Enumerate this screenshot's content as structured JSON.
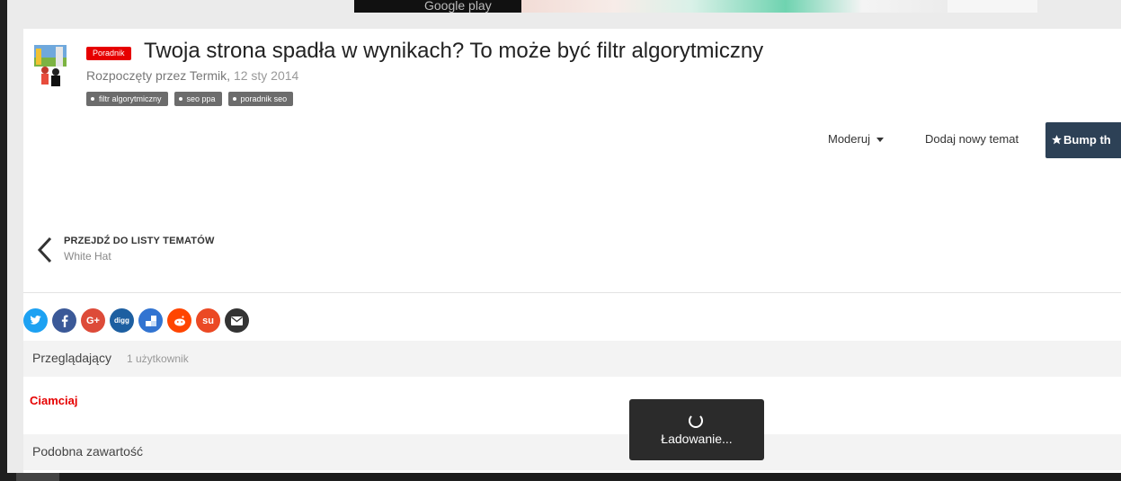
{
  "ad": {
    "store_text": "Google play",
    "colors": {
      "dark": "#111111",
      "accent": "#2eb889"
    }
  },
  "topic": {
    "badge": "Poradnik",
    "title": "Twoja strona spadła w wynikach? To może być filtr algorytmiczny",
    "started_by_prefix": "Rozpoczęty przez",
    "author": "Termik",
    "separator": ",",
    "date": "12 sty 2014",
    "tags": [
      "filtr algorytmiczny",
      "seo ppa",
      "poradnik seo"
    ]
  },
  "actions": {
    "moderate_label": "Moderuj",
    "new_topic_label": "Dodaj nowy temat",
    "bump_label": "Bump th"
  },
  "back_nav": {
    "title": "PRZEJDŹ DO LISTY TEMATÓW",
    "subtitle": "White Hat"
  },
  "share": [
    {
      "icon": "twitter-icon",
      "glyph": "t",
      "color": "#1da1f2"
    },
    {
      "icon": "facebook-icon",
      "glyph": "f",
      "color": "#3b5998"
    },
    {
      "icon": "google-plus-icon",
      "glyph": "G+",
      "color": "#dd4b39"
    },
    {
      "icon": "digg-icon",
      "glyph": "digg",
      "color": "#1d5fa1"
    },
    {
      "icon": "delicious-icon",
      "glyph": "■",
      "color": "#3274d1"
    },
    {
      "icon": "reddit-icon",
      "glyph": "☻",
      "color": "#ff4500"
    },
    {
      "icon": "stumbleupon-icon",
      "glyph": "su",
      "color": "#eb4924"
    },
    {
      "icon": "email-icon",
      "glyph": "✉",
      "color": "#333333"
    }
  ],
  "viewers": {
    "title": "Przeglądający",
    "count": "1 użytkownik",
    "users": [
      "Ciamciaj"
    ]
  },
  "similar": {
    "title": "Podobna zawartość"
  },
  "loading": {
    "text": "Ładowanie..."
  },
  "colors": {
    "badge": "#e60000",
    "bump_button": "#2d4156",
    "tag": "#6c6c6c",
    "viewer_name": "#e60000"
  }
}
